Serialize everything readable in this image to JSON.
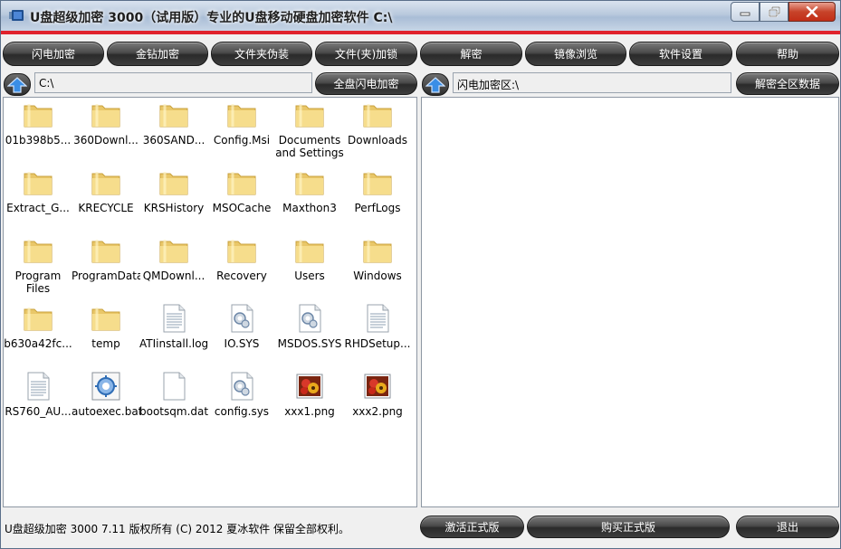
{
  "window": {
    "title": "U盘超级加密 3000（试用版）专业的U盘移动硬盘加密软件 C:\\"
  },
  "toolbar": {
    "buttons": [
      "闪电加密",
      "金钻加密",
      "文件夹伪装",
      "文件(夹)加锁",
      "解密",
      "镜像浏览",
      "软件设置",
      "帮助"
    ]
  },
  "left": {
    "path": "C:\\",
    "action_label": "全盘闪电加密",
    "items": [
      {
        "name": "01b398b5...",
        "icon": "folder-icon"
      },
      {
        "name": "360Downl...",
        "icon": "folder-icon"
      },
      {
        "name": "360SAND...",
        "icon": "folder-icon"
      },
      {
        "name": "Config.Msi",
        "icon": "folder-icon"
      },
      {
        "name": "Documents and Settings",
        "icon": "folder-icon"
      },
      {
        "name": "Downloads",
        "icon": "folder-icon"
      },
      {
        "name": "Extract_G...",
        "icon": "folder-icon"
      },
      {
        "name": "KRECYCLE",
        "icon": "folder-icon"
      },
      {
        "name": "KRSHistory",
        "icon": "folder-icon"
      },
      {
        "name": "MSOCache",
        "icon": "folder-icon"
      },
      {
        "name": "Maxthon3",
        "icon": "folder-icon"
      },
      {
        "name": "PerfLogs",
        "icon": "folder-icon"
      },
      {
        "name": "Program Files",
        "icon": "folder-icon"
      },
      {
        "name": "ProgramData",
        "icon": "folder-icon"
      },
      {
        "name": "QMDownl...",
        "icon": "folder-icon"
      },
      {
        "name": "Recovery",
        "icon": "folder-icon"
      },
      {
        "name": "Users",
        "icon": "folder-icon"
      },
      {
        "name": "Windows",
        "icon": "folder-icon"
      },
      {
        "name": "b630a42fc...",
        "icon": "folder-icon"
      },
      {
        "name": "temp",
        "icon": "folder-icon"
      },
      {
        "name": "ATIinstall.log",
        "icon": "text-file-icon"
      },
      {
        "name": "IO.SYS",
        "icon": "system-file-icon"
      },
      {
        "name": "MSDOS.SYS",
        "icon": "system-file-icon"
      },
      {
        "name": "RHDSetup...",
        "icon": "text-file-icon"
      },
      {
        "name": "RS760_AU...",
        "icon": "text-file-icon"
      },
      {
        "name": "autoexec.bat",
        "icon": "batch-file-icon"
      },
      {
        "name": "bootsqm.dat",
        "icon": "blank-file-icon"
      },
      {
        "name": "config.sys",
        "icon": "system-file-icon"
      },
      {
        "name": "xxx1.png",
        "icon": "image-file-icon"
      },
      {
        "name": "xxx2.png",
        "icon": "image-file-icon"
      }
    ]
  },
  "right": {
    "path": "闪电加密区:\\",
    "action_label": "解密全区数据"
  },
  "footer": {
    "status": "U盘超级加密 3000  7.11 版权所有 (C) 2012 夏冰软件 保留全部权利。",
    "activate_label": "激活正式版",
    "buy_label": "购买正式版",
    "exit_label": "退出"
  }
}
